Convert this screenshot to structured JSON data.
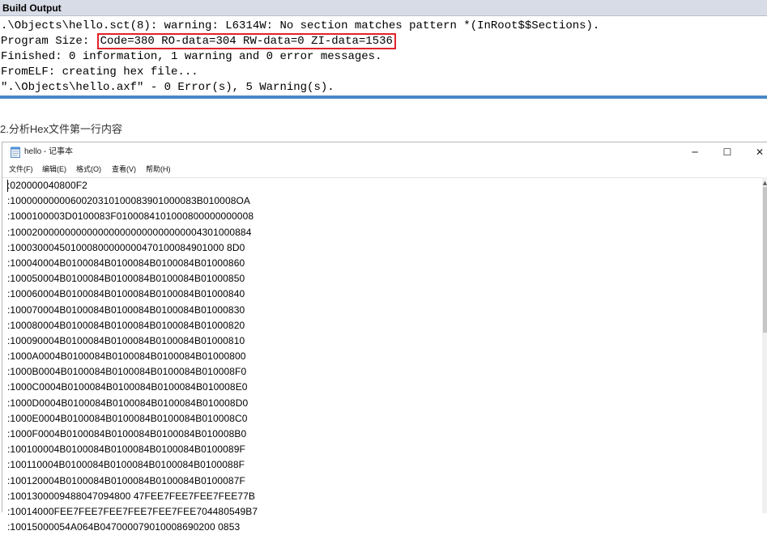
{
  "build_output": {
    "title": "Build Output",
    "lines": [
      ".\\Objects\\hello.sct(8): warning: L6314W: No section matches pattern *(InRoot$$Sections).",
      "Finished: 0 information, 1 warning and 0 error messages.",
      "FromELF: creating hex file...",
      "\".\\Objects\\hello.axf\" - 0 Error(s), 5 Warning(s)."
    ],
    "program_size_prefix": "Program Size: ",
    "program_size_highlight": "Code=380 RO-data=304 RW-data=0 ZI-data=1536",
    "highlight_color": "#e0242b"
  },
  "caption": "2.分析Hex文件第一行内容",
  "notepad": {
    "title": "hello - 记事本",
    "controls": {
      "minimize": "─",
      "maximize": "☐",
      "close": "✕"
    },
    "menu": [
      "文件(F)",
      "编辑(E)",
      "格式(O)",
      "查看(V)",
      "帮助(H)"
    ],
    "lines": [
      ":020000040800F2",
      ":1000000000060020310100083901000083B010008OA",
      ":1000100003D0100083F0100084101000800000000008",
      ":10002000000000000000000000000000004301000884",
      ":100030004501000800000000470100084901000 8D0",
      ":100040004B0100084B0100084B0100084B01000860",
      ":100050004B0100084B0100084B0100084B01000850",
      ":100060004B0100084B0100084B0100084B01000840",
      ":100070004B0100084B0100084B0100084B01000830",
      ":100080004B0100084B0100084B0100084B01000820",
      ":100090004B0100084B0100084B0100084B01000810",
      ":1000A0004B0100084B0100084B0100084B01000800",
      ":1000B0004B0100084B0100084B0100084B010008F0",
      ":1000C0004B0100084B0100084B0100084B010008E0",
      ":1000D0004B0100084B0100084B0100084B010008D0",
      ":1000E0004B0100084B0100084B0100084B010008C0",
      ":1000F0004B0100084B0100084B0100084B010008B0",
      ":100100004B0100084B0100084B0100084B0100089F",
      ":100110004B0100084B0100084B0100084B0100088F",
      ":100120004B0100084B0100084B0100084B0100087F",
      ":1001300009488047094800 47FEE7FEE7FEE7FEE77B",
      ":10014000FEE7FEE7FEE7FEE7FEE7FEE704480549B7",
      ":10015000054A064B047000079010008690200 0853"
    ]
  }
}
